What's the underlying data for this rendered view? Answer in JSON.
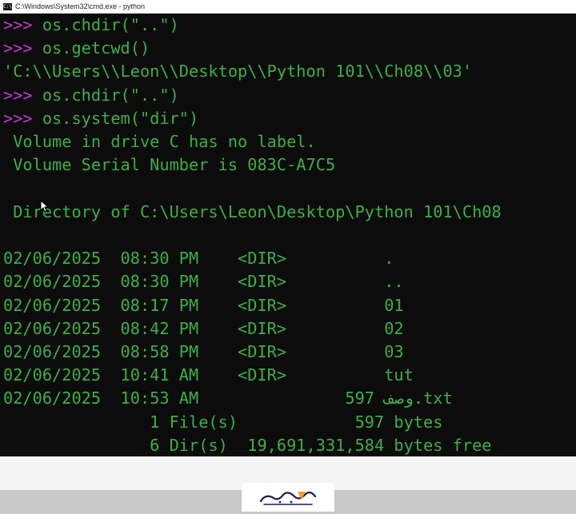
{
  "window": {
    "title": "C:\\Windows\\System32\\cmd.exe - python",
    "icon": "cmd-icon"
  },
  "console": {
    "lines": [
      {
        "prompt": ">>> ",
        "text": "os.chdir(\"..\")"
      },
      {
        "prompt": ">>> ",
        "text": "os.getcwd()"
      },
      {
        "prompt": "",
        "text": "'C:\\\\Users\\\\Leon\\\\Desktop\\\\Python 101\\\\Ch08\\\\03'"
      },
      {
        "prompt": ">>> ",
        "text": "os.chdir(\"..\")"
      },
      {
        "prompt": ">>> ",
        "text": "os.system(\"dir\")"
      },
      {
        "prompt": "",
        "text": " Volume in drive C has no label."
      },
      {
        "prompt": "",
        "text": " Volume Serial Number is 083C-A7C5"
      },
      {
        "prompt": "",
        "text": ""
      },
      {
        "prompt": "",
        "text": " Directory of C:\\Users\\Leon\\Desktop\\Python 101\\Ch08"
      },
      {
        "prompt": "",
        "text": ""
      },
      {
        "prompt": "",
        "text": "02/06/2025  08:30 PM    <DIR>          ."
      },
      {
        "prompt": "",
        "text": "02/06/2025  08:30 PM    <DIR>          .."
      },
      {
        "prompt": "",
        "text": "02/06/2025  08:17 PM    <DIR>          01"
      },
      {
        "prompt": "",
        "text": "02/06/2025  08:42 PM    <DIR>          02"
      },
      {
        "prompt": "",
        "text": "02/06/2025  08:58 PM    <DIR>          03"
      },
      {
        "prompt": "",
        "text": "02/06/2025  10:41 AM    <DIR>          tut"
      },
      {
        "prompt": "",
        "text": "02/06/2025  10:53 AM               597 وصف.txt"
      },
      {
        "prompt": "",
        "text": "               1 File(s)            597 bytes"
      },
      {
        "prompt": "",
        "text": "               6 Dir(s)  19,691,331,584 bytes free"
      }
    ]
  },
  "colors": {
    "console_bg": "#0c0c0c",
    "text_green": "#3cb043",
    "prompt_magenta": "#c23ad0"
  },
  "watermark": {
    "logo_icon": "brand-logo-icon"
  }
}
